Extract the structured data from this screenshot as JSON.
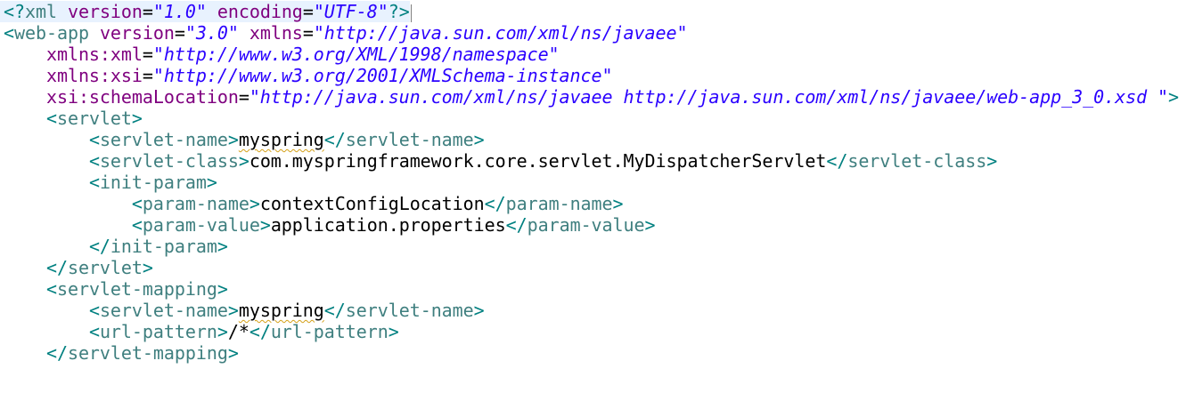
{
  "editor": {
    "language": "xml",
    "colors": {
      "bracket": "#008080",
      "tag": "#3f7f7f",
      "attribute": "#7f007f",
      "value": "#2a00ff",
      "text": "#000000",
      "current_line_highlight": "#e8f2fe",
      "spelling_underline": "#d4a017"
    },
    "lines": [
      [
        {
          "t": "bracket",
          "v": "<?"
        },
        {
          "t": "tag",
          "v": "xml"
        },
        {
          "t": "text",
          "v": " "
        },
        {
          "t": "attr",
          "v": "version"
        },
        {
          "t": "eq",
          "v": "="
        },
        {
          "t": "val",
          "v": "\"1.0\""
        },
        {
          "t": "text",
          "v": " "
        },
        {
          "t": "attr",
          "v": "encoding"
        },
        {
          "t": "eq",
          "v": "="
        },
        {
          "t": "val",
          "v": "\"UTF-8\""
        },
        {
          "t": "bracket",
          "v": "?>"
        }
      ],
      [
        {
          "t": "bracket",
          "v": "<"
        },
        {
          "t": "tag",
          "v": "web-app"
        },
        {
          "t": "text",
          "v": " "
        },
        {
          "t": "attr",
          "v": "version"
        },
        {
          "t": "eq",
          "v": "="
        },
        {
          "t": "val",
          "v": "\"3.0\""
        },
        {
          "t": "text",
          "v": " "
        },
        {
          "t": "attr",
          "v": "xmlns"
        },
        {
          "t": "eq",
          "v": "="
        },
        {
          "t": "val",
          "v": "\"http://java.sun.com/xml/ns/javaee\""
        }
      ],
      [
        {
          "t": "text",
          "v": "    "
        },
        {
          "t": "attr",
          "v": "xmlns:xml"
        },
        {
          "t": "eq",
          "v": "="
        },
        {
          "t": "val",
          "v": "\"http://www.w3.org/XML/1998/namespace\""
        }
      ],
      [
        {
          "t": "text",
          "v": "    "
        },
        {
          "t": "attr",
          "v": "xmlns:xsi"
        },
        {
          "t": "eq",
          "v": "="
        },
        {
          "t": "val",
          "v": "\"http://www.w3.org/2001/XMLSchema-instance\""
        }
      ],
      [
        {
          "t": "text",
          "v": "    "
        },
        {
          "t": "attr",
          "v": "xsi:schemaLocation"
        },
        {
          "t": "eq",
          "v": "="
        },
        {
          "t": "val",
          "v": "\"http://java.sun.com/xml/ns/javaee http://java.sun.com/xml/ns/javaee/web-app_3_0.xsd \""
        },
        {
          "t": "bracket",
          "v": ">"
        }
      ],
      [
        {
          "t": "text",
          "v": "    "
        },
        {
          "t": "bracket",
          "v": "<"
        },
        {
          "t": "tag",
          "v": "servlet"
        },
        {
          "t": "bracket",
          "v": ">"
        }
      ],
      [
        {
          "t": "text",
          "v": "        "
        },
        {
          "t": "bracket",
          "v": "<"
        },
        {
          "t": "tag",
          "v": "servlet-name"
        },
        {
          "t": "bracket",
          "v": ">"
        },
        {
          "t": "spell",
          "v": "myspring"
        },
        {
          "t": "bracket",
          "v": "</"
        },
        {
          "t": "tag",
          "v": "servlet-name"
        },
        {
          "t": "bracket",
          "v": ">"
        }
      ],
      [
        {
          "t": "text",
          "v": "        "
        },
        {
          "t": "bracket",
          "v": "<"
        },
        {
          "t": "tag",
          "v": "servlet-class"
        },
        {
          "t": "bracket",
          "v": ">"
        },
        {
          "t": "text",
          "v": "com.myspringframework.core.servlet.MyDispatcherServlet"
        },
        {
          "t": "bracket",
          "v": "</"
        },
        {
          "t": "tag",
          "v": "servlet-class"
        },
        {
          "t": "bracket",
          "v": ">"
        }
      ],
      [
        {
          "t": "text",
          "v": "        "
        },
        {
          "t": "bracket",
          "v": "<"
        },
        {
          "t": "tag",
          "v": "init-param"
        },
        {
          "t": "bracket",
          "v": ">"
        }
      ],
      [
        {
          "t": "text",
          "v": "            "
        },
        {
          "t": "bracket",
          "v": "<"
        },
        {
          "t": "tag",
          "v": "param-name"
        },
        {
          "t": "bracket",
          "v": ">"
        },
        {
          "t": "text",
          "v": "contextConfigLocation"
        },
        {
          "t": "bracket",
          "v": "</"
        },
        {
          "t": "tag",
          "v": "param-name"
        },
        {
          "t": "bracket",
          "v": ">"
        }
      ],
      [
        {
          "t": "text",
          "v": "            "
        },
        {
          "t": "bracket",
          "v": "<"
        },
        {
          "t": "tag",
          "v": "param-value"
        },
        {
          "t": "bracket",
          "v": ">"
        },
        {
          "t": "text",
          "v": "application.properties"
        },
        {
          "t": "bracket",
          "v": "</"
        },
        {
          "t": "tag",
          "v": "param-value"
        },
        {
          "t": "bracket",
          "v": ">"
        }
      ],
      [
        {
          "t": "text",
          "v": "        "
        },
        {
          "t": "bracket",
          "v": "</"
        },
        {
          "t": "tag",
          "v": "init-param"
        },
        {
          "t": "bracket",
          "v": ">"
        }
      ],
      [
        {
          "t": "text",
          "v": "    "
        },
        {
          "t": "bracket",
          "v": "</"
        },
        {
          "t": "tag",
          "v": "servlet"
        },
        {
          "t": "bracket",
          "v": ">"
        }
      ],
      [
        {
          "t": "text",
          "v": "    "
        },
        {
          "t": "bracket",
          "v": "<"
        },
        {
          "t": "tag",
          "v": "servlet-mapping"
        },
        {
          "t": "bracket",
          "v": ">"
        }
      ],
      [
        {
          "t": "text",
          "v": "        "
        },
        {
          "t": "bracket",
          "v": "<"
        },
        {
          "t": "tag",
          "v": "servlet-name"
        },
        {
          "t": "bracket",
          "v": ">"
        },
        {
          "t": "spell",
          "v": "myspring"
        },
        {
          "t": "bracket",
          "v": "</"
        },
        {
          "t": "tag",
          "v": "servlet-name"
        },
        {
          "t": "bracket",
          "v": ">"
        }
      ],
      [
        {
          "t": "text",
          "v": "        "
        },
        {
          "t": "bracket",
          "v": "<"
        },
        {
          "t": "tag",
          "v": "url-pattern"
        },
        {
          "t": "bracket",
          "v": ">"
        },
        {
          "t": "text",
          "v": "/*"
        },
        {
          "t": "bracket",
          "v": "</"
        },
        {
          "t": "tag",
          "v": "url-pattern"
        },
        {
          "t": "bracket",
          "v": ">"
        }
      ],
      [
        {
          "t": "text",
          "v": "    "
        },
        {
          "t": "bracket",
          "v": "</"
        },
        {
          "t": "tag",
          "v": "servlet-mapping"
        },
        {
          "t": "bracket",
          "v": ">"
        }
      ]
    ]
  }
}
